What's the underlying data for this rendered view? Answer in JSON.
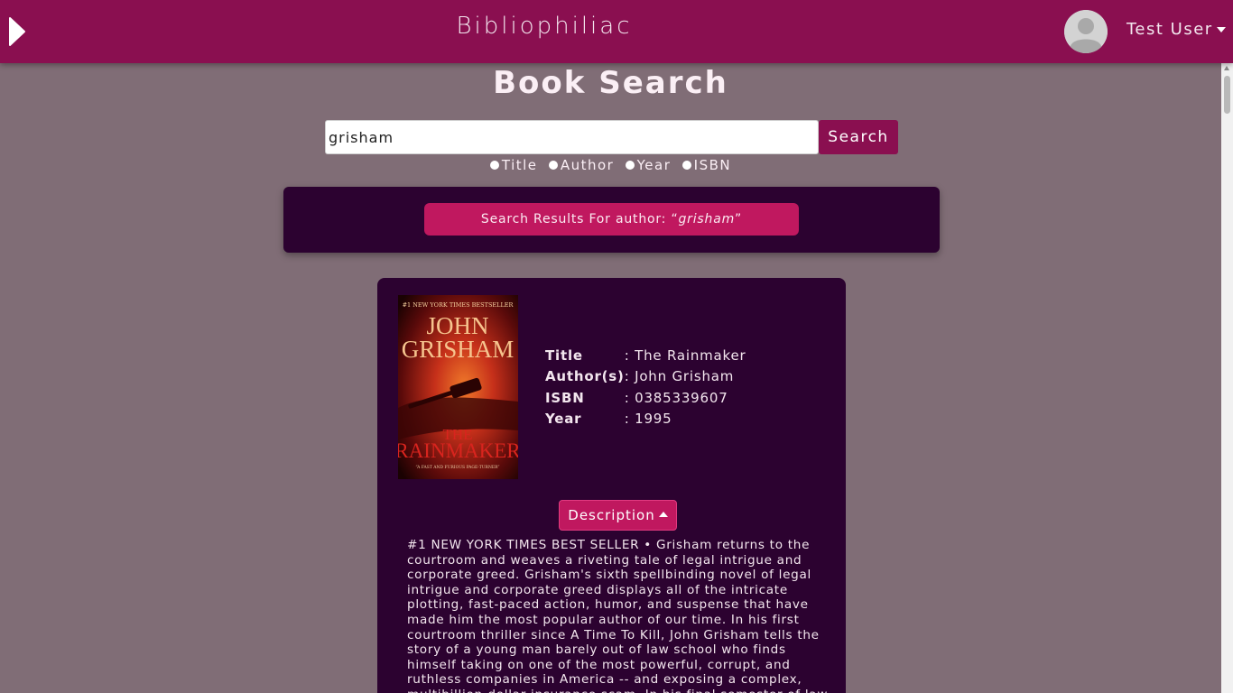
{
  "header": {
    "brand": "Bibliophiliac",
    "user_name": "Test User"
  },
  "search": {
    "page_title": "Book Search",
    "query": "grisham",
    "button_label": "Search",
    "filters": [
      {
        "label": "Title"
      },
      {
        "label": "Author"
      },
      {
        "label": "Year"
      },
      {
        "label": "ISBN"
      }
    ]
  },
  "results": {
    "prefix": "Search Results For author: “",
    "term": "grisham",
    "suffix": "”"
  },
  "book": {
    "cover": {
      "top_line": "#1 NEW YORK TIMES BESTSELLER",
      "author_first": "JOHN",
      "author_last": "GRISHAM",
      "title_the": "THE",
      "title_main": "RAINMAKER",
      "blurb": "“A FAST AND FURIOUS PAGE-TURNER”"
    },
    "fields": [
      {
        "label": "Title",
        "value": ": The Rainmaker"
      },
      {
        "label": "Author(s)",
        "value": ": John Grisham"
      },
      {
        "label": "ISBN",
        "value": ": 0385339607"
      },
      {
        "label": "Year",
        "value": ": 1995"
      }
    ],
    "description_label": "Description",
    "description": "#1 NEW YORK TIMES BEST SELLER • Grisham returns to the courtroom and weaves a riveting tale of legal intrigue and corporate greed. Grisham's sixth spellbinding novel of legal intrigue and corporate greed displays all of the intricate plotting, fast-paced action, humor, and suspense that have made him the most popular author of our time. In his first courtroom thriller since A Time To Kill, John Grisham tells the story of a young man barely out of law school who finds himself taking on one of the most powerful, corrupt, and ruthless companies in America -- and exposing a complex, multibillion-dollar insurance scam. In his final semester of law school"
  }
}
